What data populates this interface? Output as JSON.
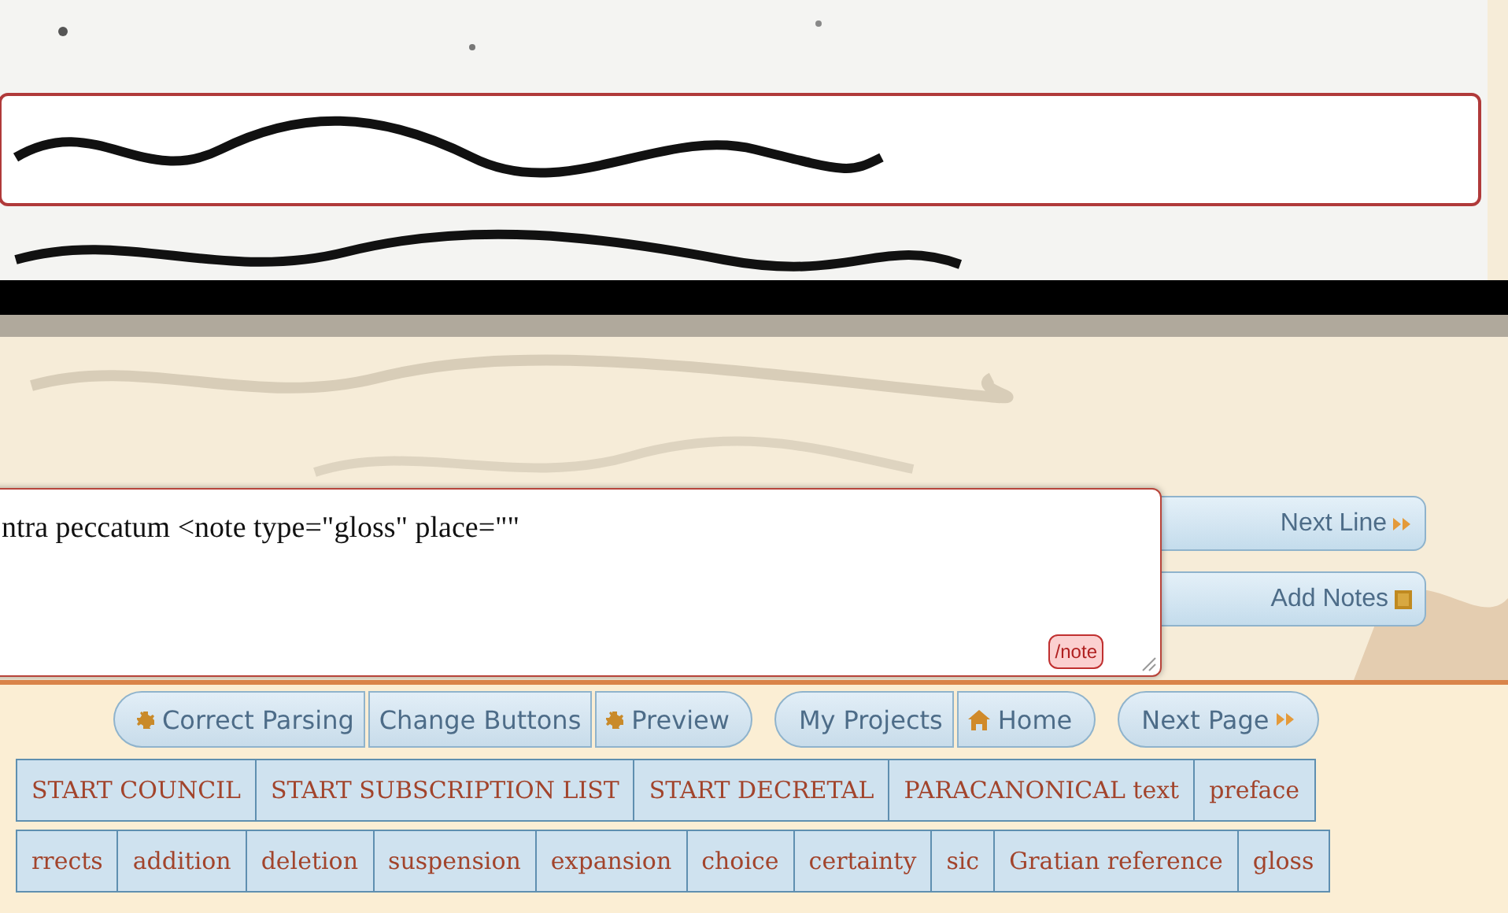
{
  "editor": {
    "value": "ntra peccatum <note type=\"gloss\" place=\"\"",
    "close_tag": "/note"
  },
  "side_buttons": [
    {
      "label": "Next Line",
      "kind": "forward"
    },
    {
      "label": "Add Notes",
      "kind": "note"
    }
  ],
  "toolbar": [
    {
      "buttons": [
        {
          "label": "Correct Parsing",
          "kind": "action"
        },
        {
          "label": "Change Buttons",
          "kind": "plain"
        },
        {
          "label": "Preview",
          "kind": "action"
        }
      ]
    },
    {
      "buttons": [
        {
          "label": "My Projects",
          "kind": "plain"
        },
        {
          "label": "Home",
          "kind": "home"
        }
      ]
    },
    {
      "buttons": [
        {
          "label": "Next Page",
          "kind": "forward"
        }
      ]
    }
  ],
  "tag_rows": [
    [
      "START COUNCIL",
      "START SUBSCRIPTION LIST",
      "START DECRETAL",
      "PARACANONICAL text",
      "preface"
    ],
    [
      "rrects",
      "addition",
      "deletion",
      "suspension",
      "expansion",
      "choice",
      "certainty",
      "sic",
      "Gratian reference",
      "gloss"
    ]
  ]
}
